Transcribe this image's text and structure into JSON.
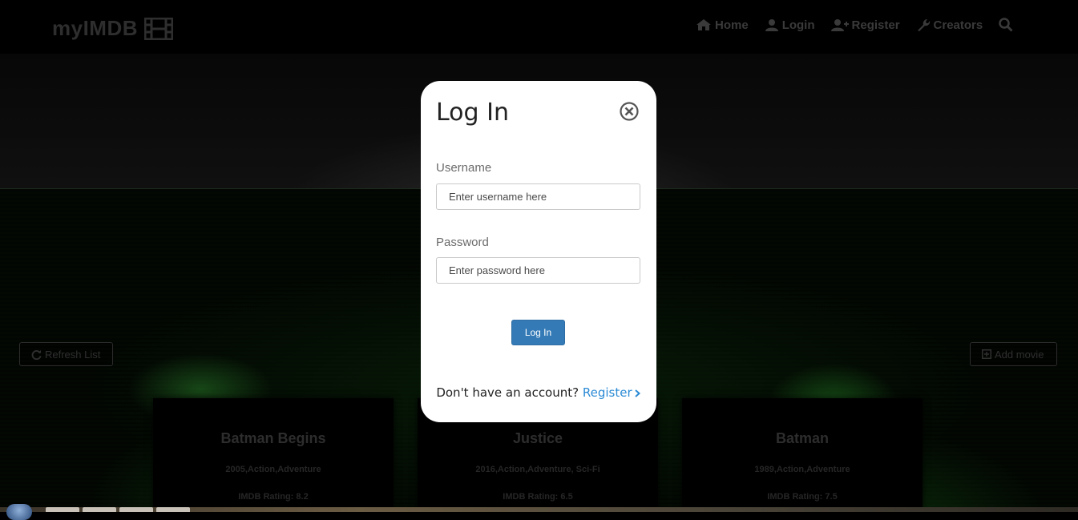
{
  "navbar": {
    "brand": "myIMDB",
    "links": [
      {
        "label": "Home",
        "icon": "home-icon"
      },
      {
        "label": "Login",
        "icon": "user-icon"
      },
      {
        "label": "Register",
        "icon": "user-plus-icon"
      },
      {
        "label": "Creators",
        "icon": "wrench-icon"
      }
    ],
    "search_icon": "search-icon"
  },
  "toolbar": {
    "refresh_label": "Refresh List",
    "add_label": "Add movie"
  },
  "movies": [
    {
      "title": "Batman Begins",
      "genre": "2005,Action,Adventure",
      "rating": "IMDB Rating: 8.2"
    },
    {
      "title": "Justice",
      "genre": "2016,Action,Adventure, Sci-Fi",
      "rating": "IMDB Rating: 6.5"
    },
    {
      "title": "Batman",
      "genre": "1989,Action,Adventure",
      "rating": "IMDB Rating: 7.5"
    }
  ],
  "login_modal": {
    "title": "Log In",
    "username_label": "Username",
    "username_placeholder": "Enter username here",
    "password_label": "Password",
    "password_placeholder": "Enter password here",
    "submit_label": "Log In",
    "register_prompt": "Don't have an account?",
    "register_link": "Register"
  },
  "colors": {
    "primary_button": "#337ab7",
    "link": "#2a8ad4"
  }
}
